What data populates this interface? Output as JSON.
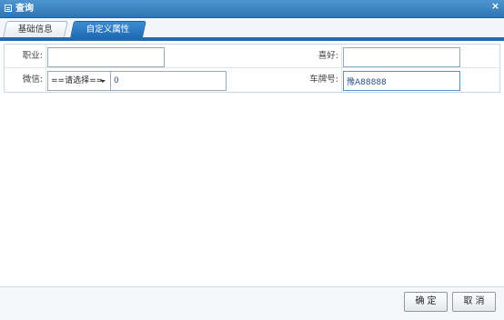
{
  "window": {
    "title": "查询",
    "close_label": "×"
  },
  "tabs": [
    {
      "label": "基础信息"
    },
    {
      "label": "自定义属性"
    }
  ],
  "form": {
    "occupation": {
      "label": "职业:",
      "value": ""
    },
    "hobby": {
      "label": "喜好:",
      "value": ""
    },
    "wechat": {
      "label": "微信:",
      "select_value": "==请选择==",
      "value": "0"
    },
    "plate": {
      "label": "车牌号:",
      "value": "豫A88888"
    }
  },
  "footer": {
    "confirm_label": "确定",
    "cancel_label": "取消"
  },
  "colors": {
    "titlebar": "#2f75b6",
    "active_tab": "#1f6bb5"
  }
}
